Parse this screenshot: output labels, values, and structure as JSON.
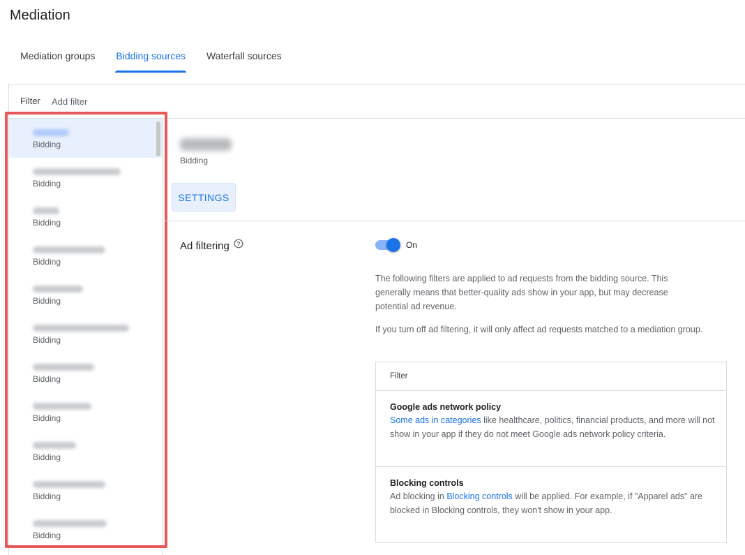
{
  "page": {
    "title": "Mediation"
  },
  "tabs": [
    {
      "label": "Mediation groups",
      "active": false
    },
    {
      "label": "Bidding sources",
      "active": true
    },
    {
      "label": "Waterfall sources",
      "active": false
    }
  ],
  "filter": {
    "label": "Filter",
    "placeholder": "Add filter"
  },
  "source_list": {
    "items": [
      {
        "type": "Bidding",
        "selected": true
      },
      {
        "type": "Bidding"
      },
      {
        "type": "Bidding"
      },
      {
        "type": "Bidding"
      },
      {
        "type": "Bidding"
      },
      {
        "type": "Bidding"
      },
      {
        "type": "Bidding"
      },
      {
        "type": "Bidding"
      },
      {
        "type": "Bidding"
      },
      {
        "type": "Bidding"
      },
      {
        "type": "Bidding"
      }
    ]
  },
  "detail": {
    "type": "Bidding",
    "settings_button": "SETTINGS",
    "ad_filtering": {
      "label": "Ad filtering",
      "toggle_state": "On",
      "description_1": "The following filters are applied to ad requests from the bidding source. This generally means that better-quality ads show in your app, but may decrease potential ad revenue.",
      "description_2": "If you turn off ad filtering, it will only affect ad requests matched to a mediation group."
    },
    "table": {
      "header": "Filter",
      "rows": [
        {
          "title": "Google ads network policy",
          "link_text": "Some ads in categories",
          "text_after": " like healthcare, politics, financial products, and more will not show in your app if they do not meet Google ads network policy criteria."
        },
        {
          "title": "Blocking controls",
          "text_before": "Ad blocking in ",
          "link_text": "Blocking controls",
          "text_after": " will be applied. For example, if \"Apparel ads\" are blocked in Blocking controls, they won't show in your app."
        }
      ]
    }
  },
  "colors": {
    "accent": "#1a73e8",
    "selected_bg": "#e8f0fe",
    "highlight_border": "#e8585a",
    "divider": "#dadce0"
  }
}
